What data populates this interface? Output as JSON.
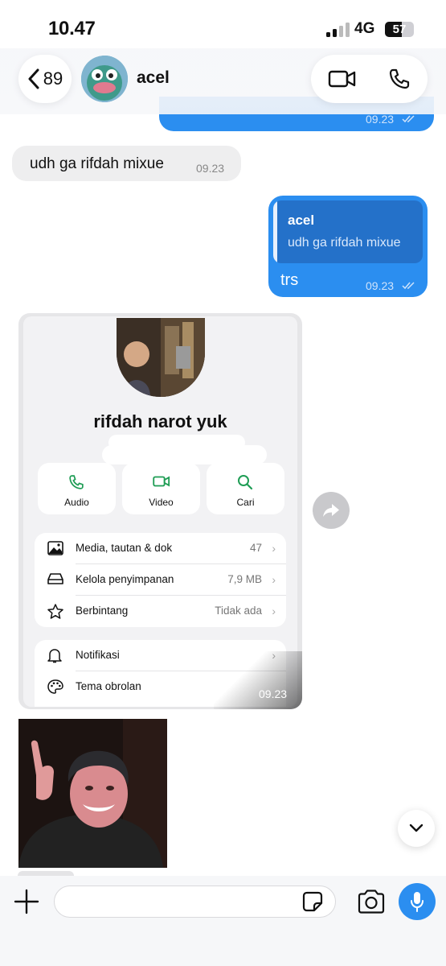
{
  "status_bar": {
    "time": "10.47",
    "network": "4G",
    "battery": "57"
  },
  "header": {
    "back_count": "89",
    "contact_name": "acel",
    "icons": [
      "chevron-left-icon",
      "video-call-icon",
      "phone-icon"
    ]
  },
  "messages": [
    {
      "id": "m0",
      "direction": "outgoing",
      "text": "",
      "time": "09.23"
    },
    {
      "id": "m1",
      "direction": "incoming",
      "text": "udh ga rifdah mixue",
      "time": "09.23"
    },
    {
      "id": "m2",
      "direction": "outgoing",
      "reply_to": {
        "author": "acel",
        "text": "udh ga rifdah mixue"
      },
      "text": "trs",
      "time": "09.23"
    },
    {
      "id": "m3",
      "direction": "incoming",
      "type": "image",
      "time": "09.23",
      "screenshot": {
        "title": "rifdah narot yuk",
        "actions": [
          {
            "label": "Audio",
            "icon": "phone-icon"
          },
          {
            "label": "Video",
            "icon": "video-icon"
          },
          {
            "label": "Cari",
            "icon": "search-icon"
          }
        ],
        "rows": [
          {
            "label": "Media, tautan & dok",
            "value": "47",
            "icon": "image-icon"
          },
          {
            "label": "Kelola penyimpanan",
            "value": "7,9 MB",
            "icon": "storage-icon"
          },
          {
            "label": "Berbintang",
            "value": "Tidak ada",
            "icon": "star-icon"
          }
        ],
        "rows2": [
          {
            "label": "Notifikasi",
            "value": "",
            "icon": "bell-icon"
          },
          {
            "label": "Tema obrolan",
            "value": "",
            "icon": "palette-icon"
          }
        ]
      }
    },
    {
      "id": "m4",
      "direction": "incoming",
      "type": "sticker"
    }
  ],
  "composer": {
    "placeholder": ""
  },
  "colors": {
    "accent": "#2b8ef0",
    "incoming_bubble": "#eeeeef",
    "whatsapp_green": "#1f9d55"
  }
}
